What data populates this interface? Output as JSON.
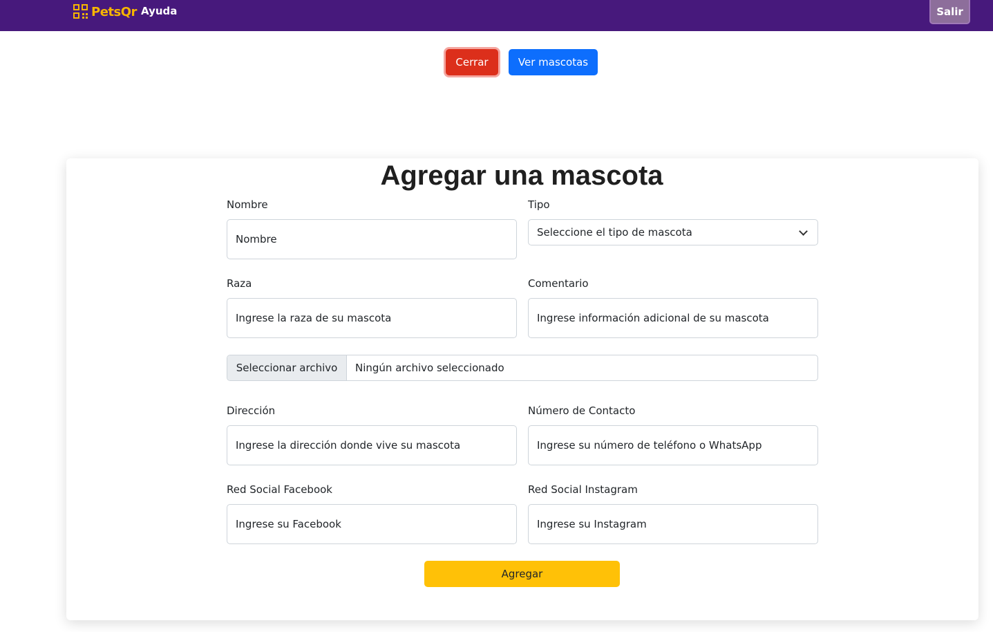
{
  "navbar": {
    "brand": "PetsQr",
    "help_link": "Ayuda",
    "logout_label": "Salir"
  },
  "actions": {
    "close_label": "Cerrar",
    "view_pets_label": "Ver mascotas"
  },
  "form": {
    "title": "Agregar una mascota",
    "name": {
      "label": "Nombre",
      "placeholder": "Nombre"
    },
    "type": {
      "label": "Tipo",
      "selected": "Seleccione el tipo de mascota"
    },
    "breed": {
      "label": "Raza",
      "placeholder": "Ingrese la raza de su mascota"
    },
    "comment": {
      "label": "Comentario",
      "placeholder": "Ingrese información adicional de su mascota"
    },
    "file": {
      "button_label": "Seleccionar archivo",
      "status": "Ningún archivo seleccionado"
    },
    "address": {
      "label": "Dirección",
      "placeholder": "Ingrese la dirección donde vive su mascota"
    },
    "contact": {
      "label": "Número de Contacto",
      "placeholder": "Ingrese su número de teléfono o WhatsApp"
    },
    "facebook": {
      "label": "Red Social Facebook",
      "placeholder": "Ingrese su Facebook"
    },
    "instagram": {
      "label": "Red Social Instagram",
      "placeholder": "Ingrese su Instagram"
    },
    "submit_label": "Agregar"
  },
  "colors": {
    "navbar": "#47197c",
    "brand": "#f7b500",
    "close_button": "#dc2f1b",
    "view_button": "#0d6efd",
    "submit_button": "#ffc107"
  },
  "icons": [
    "qr-code-icon",
    "chevron-down-icon"
  ]
}
